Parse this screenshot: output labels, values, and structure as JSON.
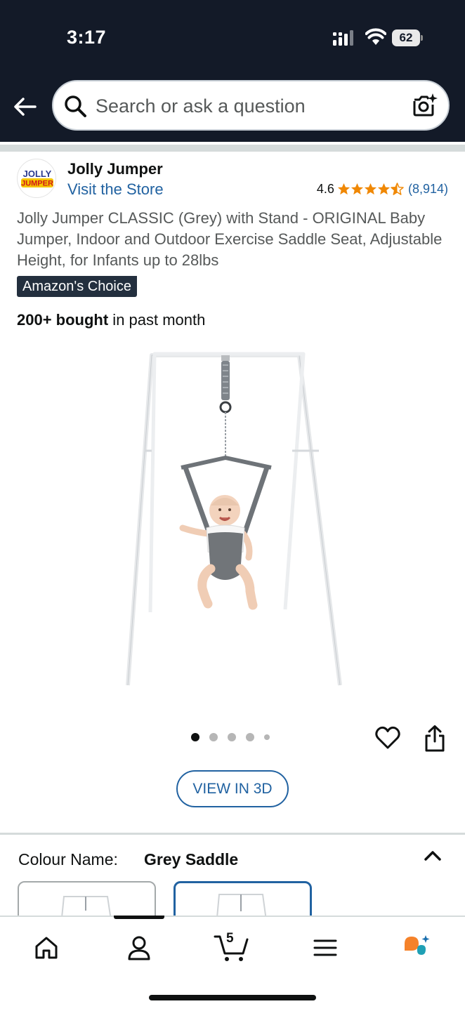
{
  "status_bar": {
    "time": "3:17",
    "battery": "62"
  },
  "header": {
    "search_placeholder": "Search or ask a question"
  },
  "brand": {
    "logo_text_top": "JOLLY",
    "logo_text_bottom": "JUMPER",
    "name": "Jolly Jumper",
    "store_link": "Visit the Store"
  },
  "rating": {
    "value": "4.6",
    "stars": 4.6,
    "count": "(8,914)"
  },
  "product": {
    "title": "Jolly Jumper CLASSIC (Grey) with Stand - ORIGINAL Baby Jumper, Indoor and Outdoor Exercise Saddle Seat, Adjustable Height, for Infants up to 28lbs",
    "badge": "Amazon's Choice",
    "bought_bold": "200+ bought",
    "bought_rest": " in past month",
    "image_count": 5,
    "active_image": 1,
    "view_3d": "VIEW IN 3D"
  },
  "variation": {
    "label": "Colour Name:",
    "value": "Grey Saddle"
  },
  "bottom_nav": {
    "cart_count": "5"
  },
  "colors": {
    "header_bg": "#131a28",
    "link": "#2162a1",
    "star": "#f08804",
    "badge_bg": "#232f3e"
  }
}
